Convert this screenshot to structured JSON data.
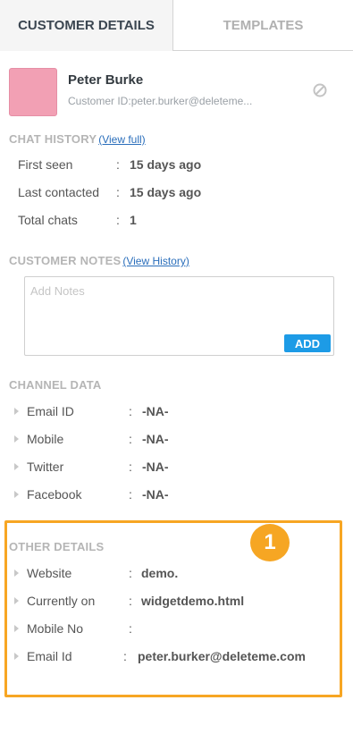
{
  "tabs": [
    {
      "label": "CUSTOMER DETAILS",
      "active": true
    },
    {
      "label": "TEMPLATES",
      "active": false
    }
  ],
  "customer": {
    "name": "Peter Burke",
    "id_label": "Customer ID:",
    "id_value": "peter.burker@deleteme...",
    "avatar_color": "#f2a0b4"
  },
  "chat_history": {
    "title": "CHAT HISTORY",
    "link": "(View full)",
    "rows": [
      {
        "label": "First seen",
        "value": "15 days ago"
      },
      {
        "label": "Last contacted",
        "value": "15 days ago"
      },
      {
        "label": "Total chats",
        "value": "1"
      }
    ]
  },
  "customer_notes": {
    "title": "CUSTOMER NOTES",
    "link": "(View History)",
    "placeholder": "Add Notes",
    "add_label": "ADD"
  },
  "channel_data": {
    "title": "CHANNEL DATA",
    "rows": [
      {
        "label": "Email ID",
        "value": "-NA-"
      },
      {
        "label": "Mobile",
        "value": "-NA-"
      },
      {
        "label": "Twitter",
        "value": "-NA-"
      },
      {
        "label": "Facebook",
        "value": "-NA-"
      }
    ]
  },
  "other_details": {
    "title": "OTHER DETAILS",
    "rows": [
      {
        "label": "Website",
        "value": "demo."
      },
      {
        "label": "Currently on",
        "value": "widgetdemo.html"
      },
      {
        "label": "Mobile No",
        "value": ""
      },
      {
        "label": "Email Id",
        "value": "peter.burker@deleteme.com"
      }
    ]
  },
  "annotation": {
    "marker": "1",
    "color": "#f7a623"
  },
  "colors": {
    "accent": "#1d9be6",
    "link": "#2a6ebb",
    "highlight": "#f7a623"
  }
}
